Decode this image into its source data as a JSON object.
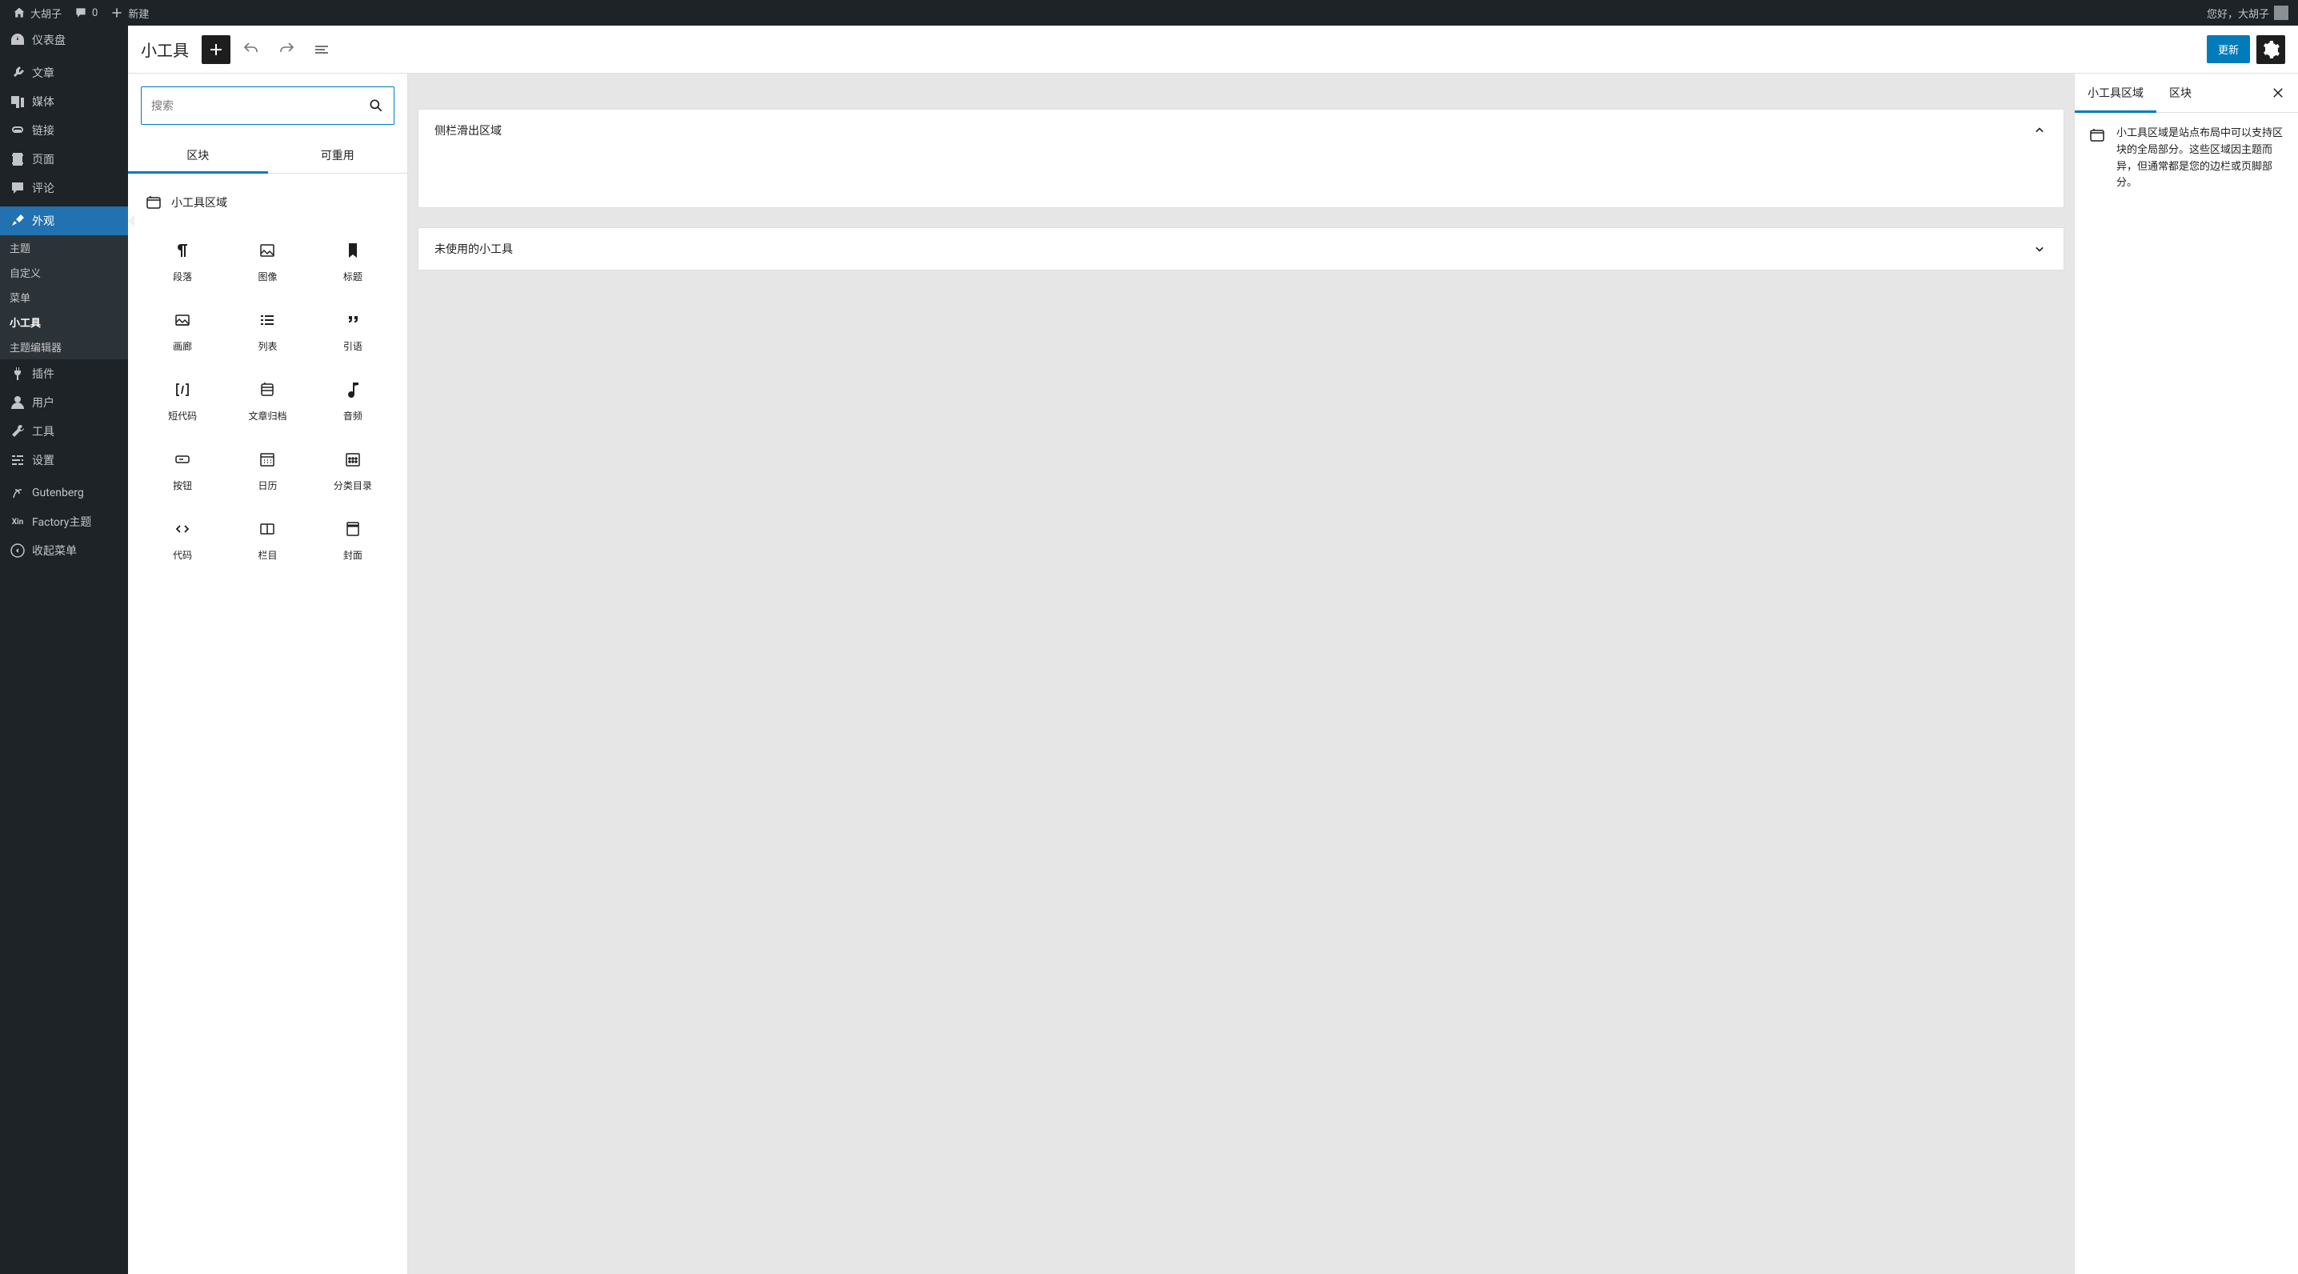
{
  "adminbar": {
    "site_name": "大胡子",
    "comment_count": "0",
    "new_label": "新建",
    "greeting": "您好，大胡子"
  },
  "sidebar": {
    "items": [
      {
        "id": "dashboard",
        "label": "仪表盘",
        "icon": "dashboard"
      },
      {
        "id": "posts",
        "label": "文章",
        "icon": "pin"
      },
      {
        "id": "media",
        "label": "媒体",
        "icon": "media"
      },
      {
        "id": "links",
        "label": "链接",
        "icon": "link"
      },
      {
        "id": "pages",
        "label": "页面",
        "icon": "page"
      },
      {
        "id": "comments",
        "label": "评论",
        "icon": "comment"
      },
      {
        "id": "appearance",
        "label": "外观",
        "icon": "brush",
        "current": true,
        "sub": [
          {
            "label": "主题"
          },
          {
            "label": "自定义"
          },
          {
            "label": "菜单"
          },
          {
            "label": "小工具",
            "active": true
          },
          {
            "label": "主题编辑器"
          }
        ]
      },
      {
        "id": "plugins",
        "label": "插件",
        "icon": "plug"
      },
      {
        "id": "users",
        "label": "用户",
        "icon": "user"
      },
      {
        "id": "tools",
        "label": "工具",
        "icon": "wrench"
      },
      {
        "id": "settings",
        "label": "设置",
        "icon": "sliders"
      },
      {
        "id": "gutenberg",
        "label": "Gutenberg",
        "icon": "gutenberg"
      },
      {
        "id": "factory",
        "label": "Factory主题",
        "icon": "xin"
      },
      {
        "id": "collapse",
        "label": "收起菜单",
        "icon": "collapse"
      }
    ]
  },
  "editor": {
    "title": "小工具",
    "update_label": "更新"
  },
  "inserter": {
    "search_placeholder": "搜索",
    "tabs": {
      "blocks": "区块",
      "reusable": "可重用"
    },
    "category_label": "小工具区域",
    "blocks": [
      {
        "label": "段落",
        "icon": "paragraph"
      },
      {
        "label": "图像",
        "icon": "image"
      },
      {
        "label": "标题",
        "icon": "bookmark"
      },
      {
        "label": "画廊",
        "icon": "gallery"
      },
      {
        "label": "列表",
        "icon": "list"
      },
      {
        "label": "引语",
        "icon": "quote"
      },
      {
        "label": "短代码",
        "icon": "shortcode"
      },
      {
        "label": "文章归档",
        "icon": "archive"
      },
      {
        "label": "音频",
        "icon": "audio"
      },
      {
        "label": "按钮",
        "icon": "button"
      },
      {
        "label": "日历",
        "icon": "calendar"
      },
      {
        "label": "分类目录",
        "icon": "categories"
      },
      {
        "label": "代码",
        "icon": "code"
      },
      {
        "label": "栏目",
        "icon": "columns"
      },
      {
        "label": "封面",
        "icon": "cover"
      }
    ]
  },
  "canvas": {
    "areas": [
      {
        "title": "侧栏滑出区域",
        "expanded": true
      },
      {
        "title": "未使用的小工具",
        "expanded": false
      }
    ]
  },
  "settings_panel": {
    "tabs": {
      "area": "小工具区域",
      "block": "区块"
    },
    "description": "小工具区域是站点布局中可以支持区块的全局部分。这些区域因主题而异，但通常都是您的边栏或页脚部分。"
  }
}
